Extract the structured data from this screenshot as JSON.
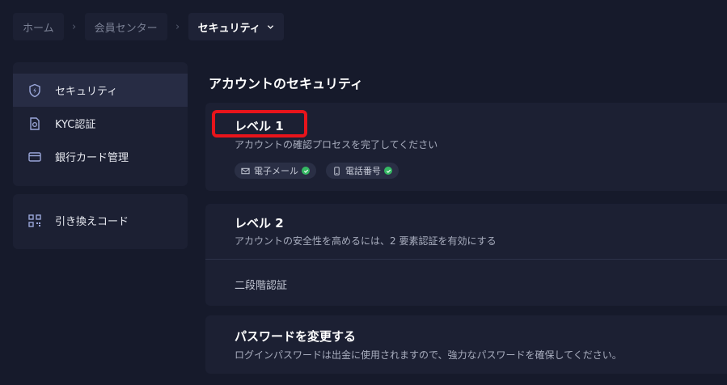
{
  "breadcrumb": {
    "home": "ホーム",
    "member_center": "会員センター",
    "current": "セキュリティ",
    "separator": "›"
  },
  "sidebar": {
    "items": [
      {
        "label": "セキュリティ",
        "icon": "shield-icon"
      },
      {
        "label": "KYC認証",
        "icon": "kyc-document-icon"
      },
      {
        "label": "銀行カード管理",
        "icon": "bank-card-icon"
      }
    ],
    "redeem": {
      "label": "引き換えコード",
      "icon": "qr-code-icon"
    }
  },
  "main": {
    "title": "アカウントのセキュリティ",
    "level1": {
      "title": "レベル 1",
      "description": "アカウントの確認プロセスを完了してください",
      "badges": [
        {
          "label": "電子メール",
          "icon": "mail-icon",
          "verified": true
        },
        {
          "label": "電話番号",
          "icon": "phone-icon",
          "verified": true
        }
      ]
    },
    "level2": {
      "title": "レベル 2",
      "description": "アカウントの安全性を高めるには、2 要素認証を有効にする",
      "two_step": "二段階認証"
    },
    "password": {
      "title": "パスワードを変更する",
      "description": "ログインパスワードは出金に使用されますので、強力なパスワードを確保してください。"
    }
  },
  "colors": {
    "background": "#161a2b",
    "panel": "#1c2033",
    "active": "#272c44",
    "highlight": "#e8141b",
    "verified": "#35b863"
  }
}
